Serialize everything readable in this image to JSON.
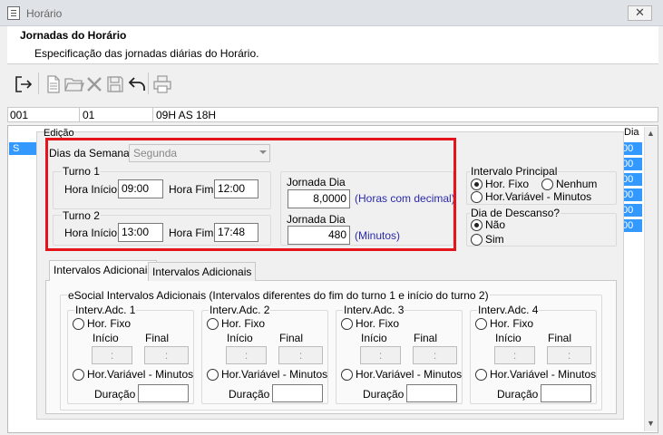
{
  "window": {
    "title": "Horário",
    "close_glyph": "✕"
  },
  "header": {
    "title": "Jornadas do Horário",
    "subtitle": "Especificação das jornadas diárias do Horário."
  },
  "toolbar": {
    "icons": [
      "exit-icon",
      "new-document-icon",
      "open-folder-icon",
      "delete-icon",
      "save-icon",
      "undo-icon",
      "print-icon"
    ]
  },
  "record": {
    "col1": "001",
    "col2": "01",
    "col3": "09H AS 18H"
  },
  "grid": {
    "selected_cell": "S",
    "dia_header": "Dia",
    "right_cells": [
      "00",
      "00",
      "00",
      "00",
      "00",
      "00"
    ]
  },
  "panel": {
    "title": "Edição",
    "dias_semana": {
      "label": "Dias da Semana",
      "value": "Segunda"
    },
    "turno1": {
      "label": "Turno 1",
      "hora_inicio_label": "Hora Início",
      "hora_inicio": "09:00",
      "hora_fim_label": "Hora Fim",
      "hora_fim": "12:00"
    },
    "turno2": {
      "label": "Turno 2",
      "hora_inicio_label": "Hora Início",
      "hora_inicio": "13:00",
      "hora_fim_label": "Hora Fim",
      "hora_fim": "17:48"
    },
    "jornada_horas": {
      "label": "Jornada Dia",
      "value": "8,0000",
      "unit": "(Horas com decimal)"
    },
    "jornada_minutos": {
      "label": "Jornada Dia",
      "value": "480",
      "unit": "(Minutos)"
    },
    "intervalo_principal": {
      "label": "Intervalo Principal",
      "options": [
        "Hor. Fixo",
        "Nenhum",
        "Hor.Variável - Minutos"
      ],
      "selected": "Hor. Fixo"
    },
    "dia_descanso": {
      "label": "Dia de Descanso?",
      "options": [
        "Não",
        "Sim"
      ],
      "selected": "Não"
    },
    "tabs": [
      "Intervalos Adicionais",
      "Intervalos Adicionais"
    ],
    "esocial": {
      "label": "eSocial Intervalos Adicionais  (Intervalos diferentes do fim do turno 1 e início do turno 2)",
      "groups": [
        {
          "label": "Interv.Adc. 1",
          "fixo": "Hor. Fixo",
          "inicio": "Início",
          "final": "Final",
          "inicio_value": ":",
          "final_value": ":",
          "variavel": "Hor.Variável - Minutos",
          "duracao": "Duração",
          "duracao_value": ""
        },
        {
          "label": "Interv.Adc. 2",
          "fixo": "Hor. Fixo",
          "inicio": "Início",
          "final": "Final",
          "inicio_value": ":",
          "final_value": ":",
          "variavel": "Hor.Variável - Minutos",
          "duracao": "Duração",
          "duracao_value": ""
        },
        {
          "label": "Interv.Adc. 3",
          "fixo": "Hor. Fixo",
          "inicio": "Início",
          "final": "Final",
          "inicio_value": ":",
          "final_value": ":",
          "variavel": "Hor.Variável - Minutos",
          "duracao": "Duração",
          "duracao_value": ""
        },
        {
          "label": "Interv.Adc. 4",
          "fixo": "Hor. Fixo",
          "inicio": "Início",
          "final": "Final",
          "inicio_value": ":",
          "final_value": ":",
          "variavel": "Hor.Variável - Minutos",
          "duracao": "Duração",
          "duracao_value": ""
        }
      ]
    }
  },
  "colors": {
    "highlight_border": "#e5141b",
    "selection": "#3399ff",
    "unit_text": "#2a2aaa"
  }
}
